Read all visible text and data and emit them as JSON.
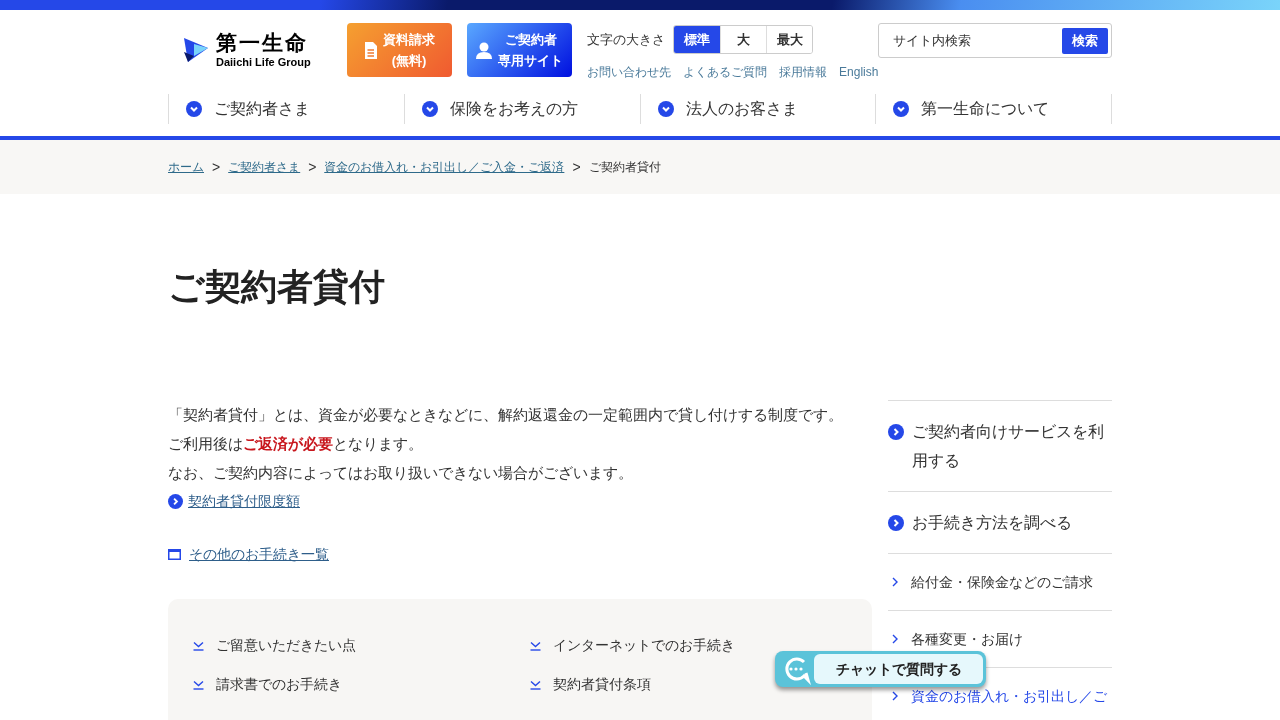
{
  "logo": {
    "name": "第一生命",
    "sub": "Daiichi Life Group"
  },
  "header_buttons": [
    {
      "kind": "document",
      "lines": [
        "資料請求",
        "(無料)"
      ]
    },
    {
      "kind": "person",
      "lines": [
        "ご契約者",
        "専用サイト"
      ]
    }
  ],
  "font_size": {
    "label": "文字の大きさ",
    "options": [
      {
        "label": "標準",
        "selected": true
      },
      {
        "label": "大",
        "selected": false
      },
      {
        "label": "最大",
        "selected": false
      }
    ]
  },
  "utility_links": [
    "お問い合わせ先",
    "よくあるご質問",
    "採用情報",
    "English"
  ],
  "search": {
    "placeholder": "サイト内検索",
    "button": "検索"
  },
  "nav": [
    "ご契約者さま",
    "保険をお考えの方",
    "法人のお客さま",
    "第一生命について"
  ],
  "breadcrumb": [
    {
      "label": "ホーム",
      "link": true
    },
    {
      "separator": ">",
      "label": "ご契約者さま",
      "link": true
    },
    {
      "separator": ">",
      "label": "資金のお借入れ・お引出し／ご入金・ご返済",
      "link": true
    },
    {
      "separator": ">",
      "label": "ご契約者貸付",
      "link": false
    }
  ],
  "title": "ご契約者貸付",
  "intro": [
    "「契約者貸付」とは、資金が必要なときなどに、解約返還金の一定範囲内で貸し付けする制度です。",
    "ご利用後は**ご返済が必要**となります。",
    "なお、ご契約内容によってはお取り扱いできない場合がございます。"
  ],
  "detail_link": "契約者貸付限度額",
  "other_link": "その他のお手続き一覧",
  "anchor_links": [
    "ご留意いただきたい点",
    "インターネットでのお手続き",
    "請求書でのお手続き",
    "契約者貸付条項"
  ],
  "sidebar": [
    {
      "kind": "primary",
      "label": "ご契約者向けサービスを利用する",
      "current": false
    },
    {
      "kind": "primary",
      "label": "お手続き方法を調べる",
      "current": false
    },
    {
      "kind": "sub",
      "label": "給付金・保険金などのご請求",
      "current": false
    },
    {
      "kind": "sub",
      "label": "各種変更・お届け",
      "current": false
    },
    {
      "kind": "sub",
      "label": "資金のお借入れ・お引出し／ご",
      "current": true
    }
  ],
  "chat_button": "チャットで質問する"
}
